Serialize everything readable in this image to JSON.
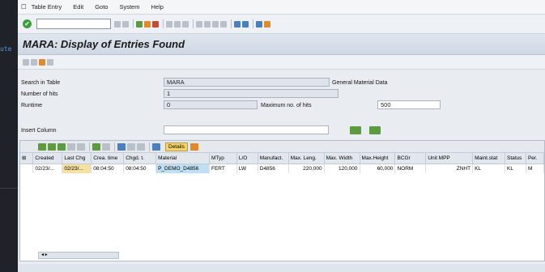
{
  "left_strip": {
    "code": "ute"
  },
  "menu": {
    "items": [
      "Table Entry",
      "Edit",
      "Goto",
      "System",
      "Help"
    ]
  },
  "toolbar": {
    "command_value": ""
  },
  "title": "MARA: Display of Entries Found",
  "form": {
    "search_table_label": "Search in Table",
    "search_table_value": "MARA",
    "search_table_desc": "General Material Data",
    "hits_label": "Number of hits",
    "hits_value": "1",
    "runtime_label": "Runtime",
    "runtime_value": "0",
    "max_hits_label": "Maximum no. of hits",
    "max_hits_value": "500",
    "insert_column_label": "Insert Column",
    "insert_column_value": ""
  },
  "grid_toolbar": {
    "details_label": "Details"
  },
  "table": {
    "columns": [
      "Created",
      "Last Chg",
      "Crea. time",
      "Chgd. t.",
      "Material",
      "MTyp",
      "L/O",
      "Manufact.",
      "Max. Leng.",
      "Max. Width",
      "Max.Height",
      "BCGr",
      "Unit MPP",
      "Maint.stat",
      "Status",
      "Per."
    ],
    "rows": [
      [
        "02/23/...",
        "02/23/...",
        "08:04:50",
        "08:04:50",
        "P_DEMO_D4856",
        "FERT",
        "LW",
        "D4856",
        "220,000",
        "120,000",
        "60,000",
        "NORM",
        "ZNHT",
        "KL",
        "KL",
        "M"
      ]
    ]
  },
  "scroll": {
    "label": "◂ ▸"
  }
}
